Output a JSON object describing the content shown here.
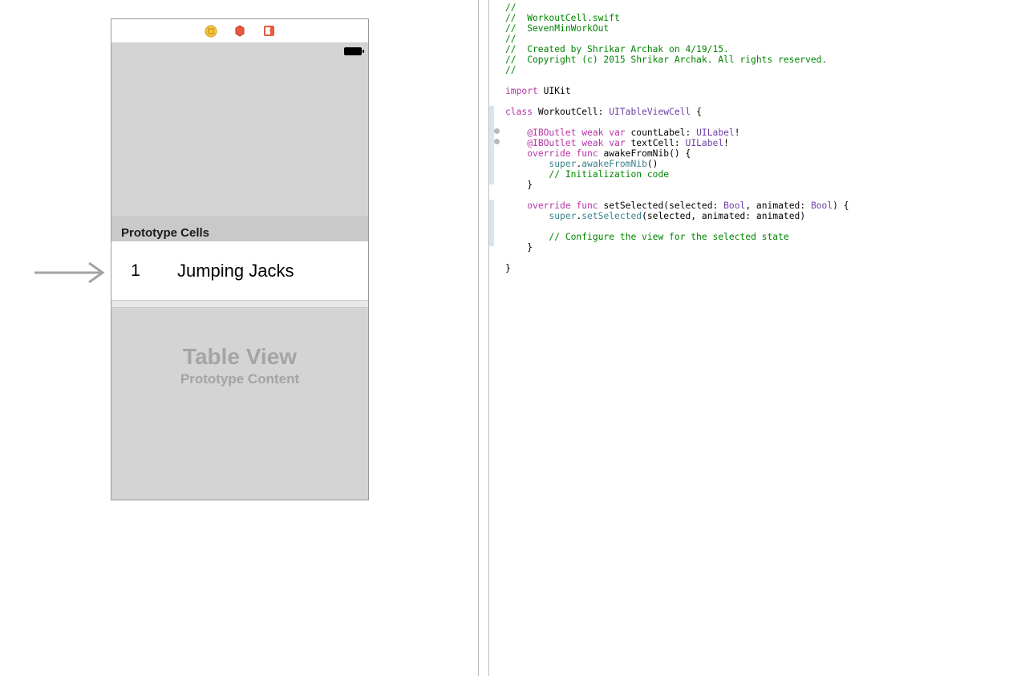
{
  "ib": {
    "proto_header": "Prototype Cells",
    "cell_count": "1",
    "cell_text": "Jumping Jacks",
    "tv_title": "Table View",
    "tv_sub": "Prototype Content"
  },
  "code": {
    "c1": "//",
    "c2": "//  WorkoutCell.swift",
    "c3": "//  SevenMinWorkOut",
    "c4": "//",
    "c5": "//  Created by Shrikar Archak on 4/19/15.",
    "c6": "//  Copyright (c) 2015 Shrikar Archak. All rights reserved.",
    "c7": "//",
    "kw_import": "import",
    "uikit": " UIKit",
    "kw_class": "class",
    "class_decl": " WorkoutCell: ",
    "type_tvc": "UITableViewCell",
    "brace_open": " {",
    "iboutlet1_a": "@IBOutlet",
    "iboutlet1_b": "weak",
    "iboutlet1_c": "var",
    "iboutlet1_d": " countLabel: ",
    "uilabel": "UILabel",
    "bang": "!",
    "iboutlet2_d": " textCell: ",
    "kw_override": "override",
    "kw_func": "func",
    "awake_sig": " awakeFromNib() {",
    "super_kw": "super",
    "dot": ".",
    "awake_call": "awakeFromNib",
    "parens": "()",
    "init_comment": "// Initialization code",
    "brace_close": "}",
    "setsel_sig_a": " setSelected(selected: ",
    "bool": "Bool",
    "setsel_sig_b": ", animated: ",
    "setsel_sig_c": ") {",
    "setsel_call": "setSelected",
    "setsel_args": "(selected, animated: animated)",
    "config_comment": "// Configure the view for the selected state"
  }
}
